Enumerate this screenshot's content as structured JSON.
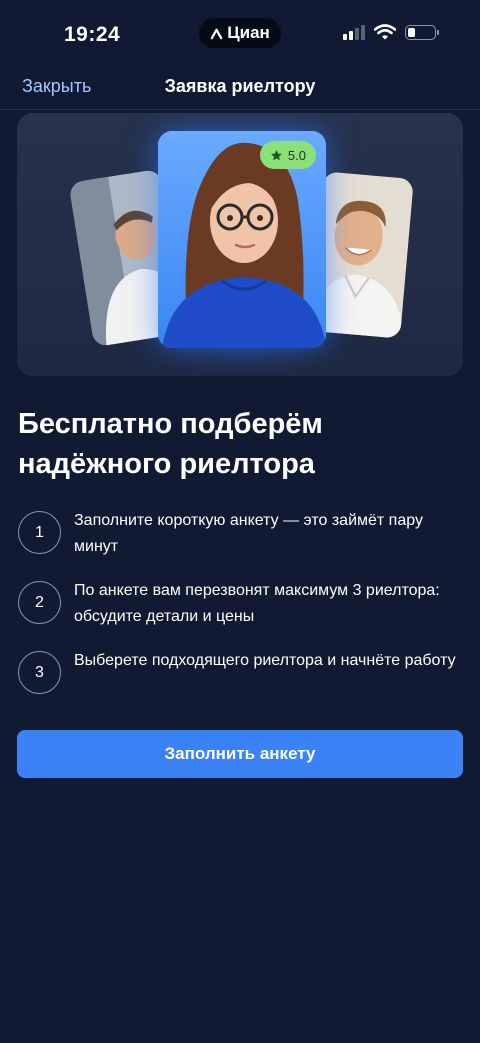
{
  "status_bar": {
    "time": "19:24",
    "app_pill": "Циан",
    "icons": [
      "signal-icon",
      "wifi-icon",
      "battery-icon"
    ]
  },
  "nav": {
    "close_label": "Закрыть",
    "title": "Заявка риелтору"
  },
  "hero": {
    "rating": "5.0",
    "icons": [
      "star-icon"
    ]
  },
  "heading": "Бесплатно подберём надёжного риелтора",
  "steps": [
    {
      "number": "1",
      "text": "Заполните короткую анкету — это займёт пару минут"
    },
    {
      "number": "2",
      "text": "По анкете вам перезвонят максимум 3 риелтора: обсудите детали и цены"
    },
    {
      "number": "3",
      "text": "Выберете подходящего риелтора и начнёте работу"
    }
  ],
  "cta_label": "Заполнить анкету",
  "colors": {
    "background": "#101a33",
    "accent": "#3b82f7",
    "link": "#a9c4ff",
    "rating_badge": "#8be07a"
  }
}
